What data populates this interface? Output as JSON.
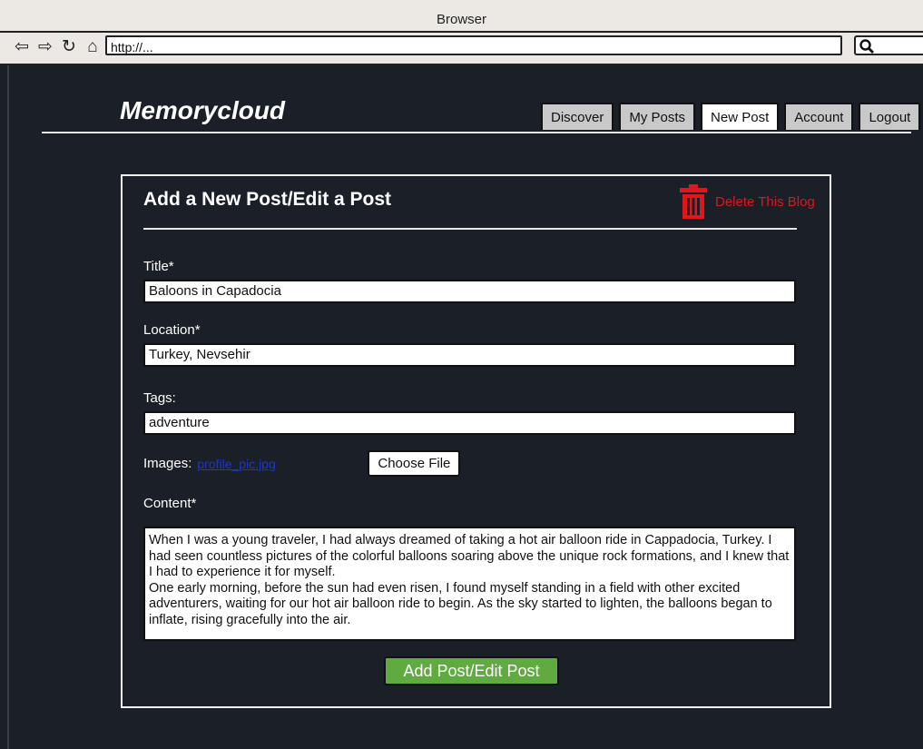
{
  "window": {
    "title": "Browser"
  },
  "browser": {
    "url": "http://...",
    "icons": [
      "back-arrow-icon",
      "forward-arrow-icon",
      "reload-icon",
      "home-icon",
      "search-icon"
    ]
  },
  "site": {
    "brand": "Memorycloud",
    "tabs": [
      {
        "label": "Discover",
        "active": false
      },
      {
        "label": "My Posts",
        "active": false
      },
      {
        "label": "New Post",
        "active": true
      },
      {
        "label": "Account",
        "active": false
      },
      {
        "label": "Logout",
        "active": false
      }
    ]
  },
  "form": {
    "title": "Add a New Post/Edit a Post",
    "delete_label": "Delete This Blog",
    "title_label": "Title*",
    "title_value": "Baloons in Capadocia",
    "location_label": "Location*",
    "location_value": "Turkey, Nevsehir",
    "tags_label": "Tags:",
    "tags_value": "adventure",
    "images_label": "Images:",
    "images_file": "profile_pic.jpg",
    "choose_file_label": "Choose File",
    "content_label": "Content*",
    "content_paragraphs": [
      "When I was a young traveler, I had always dreamed of taking a hot air balloon ride in Cappadocia, Turkey. I had seen countless pictures of the colorful balloons soaring above the unique rock formations, and I knew that I had to experience it for myself.",
      "One early morning, before the sun had even risen, I found myself standing in a field with other excited adventurers, waiting for our hot air balloon ride to begin. As the sky started to lighten, the balloons began to inflate, rising gracefully into the air."
    ],
    "submit_label": "Add Post/Edit Post"
  },
  "colors": {
    "background": "#1b1f27",
    "delete": "#e0161b",
    "submit": "#5fab3f",
    "link": "#1a35d8"
  }
}
